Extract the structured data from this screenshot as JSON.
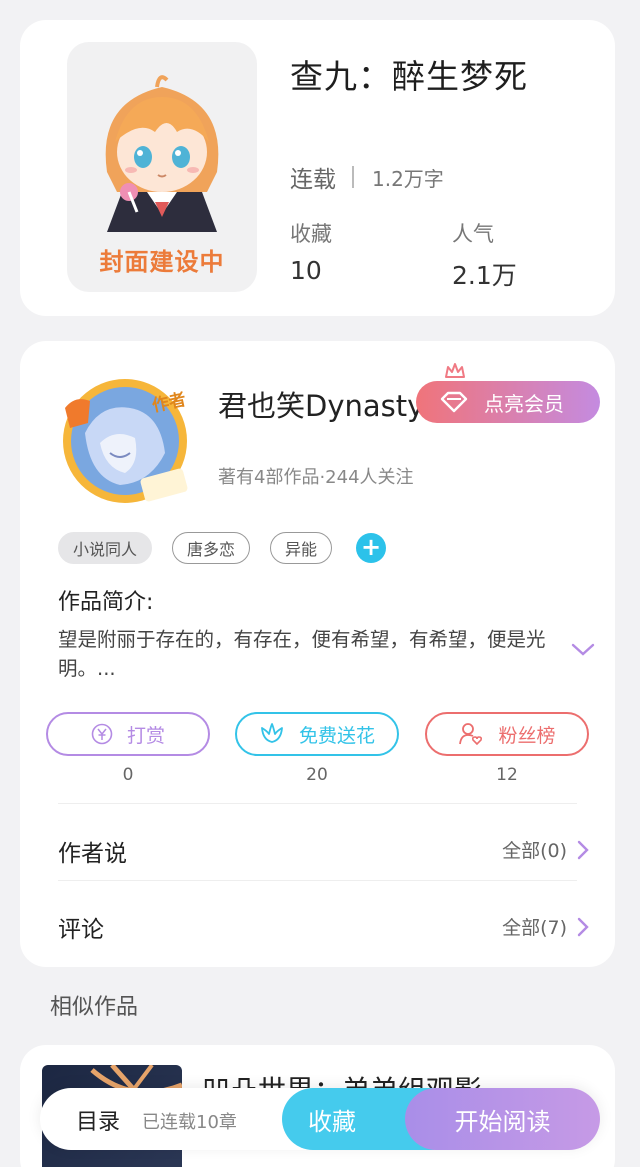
{
  "book": {
    "title": "查九：醉生梦死",
    "cover_text": "封面建设中",
    "status": "连载",
    "word_count": "1.2万字",
    "favorites_label": "收藏",
    "favorites_value": "10",
    "popularity_label": "人气",
    "popularity_value": "2.1万"
  },
  "author": {
    "badge_text": "作者",
    "name": "君也笑Dynasty",
    "vip_label": "点亮会员",
    "meta": "著有4部作品·244人关注"
  },
  "tags": [
    "小说同人",
    "唐多恋",
    "异能"
  ],
  "intro": {
    "title": "作品简介:",
    "text": "望是附丽于存在的，有存在，便有希望，有希望，便是光明。..."
  },
  "actions": {
    "reward_label": "打赏",
    "reward_count": "0",
    "flower_label": "免费送花",
    "flower_count": "20",
    "fans_label": "粉丝榜",
    "fans_count": "12"
  },
  "rows": {
    "author_says_label": "作者说",
    "author_says_link": "全部(0)",
    "comments_label": "评论",
    "comments_link": "全部(7)"
  },
  "similar": {
    "section_title": "相似作品",
    "first_title": "凹凸世界：弟弟组观影"
  },
  "bottom_bar": {
    "toc_label": "目录",
    "toc_count": "已连载10章",
    "collect_label": "收藏",
    "read_label": "开始阅读"
  },
  "colors": {
    "reward": "#b48be4",
    "flower": "#33c3e8",
    "fans": "#ec6e6e",
    "cover_text": "#ec7b3a"
  }
}
